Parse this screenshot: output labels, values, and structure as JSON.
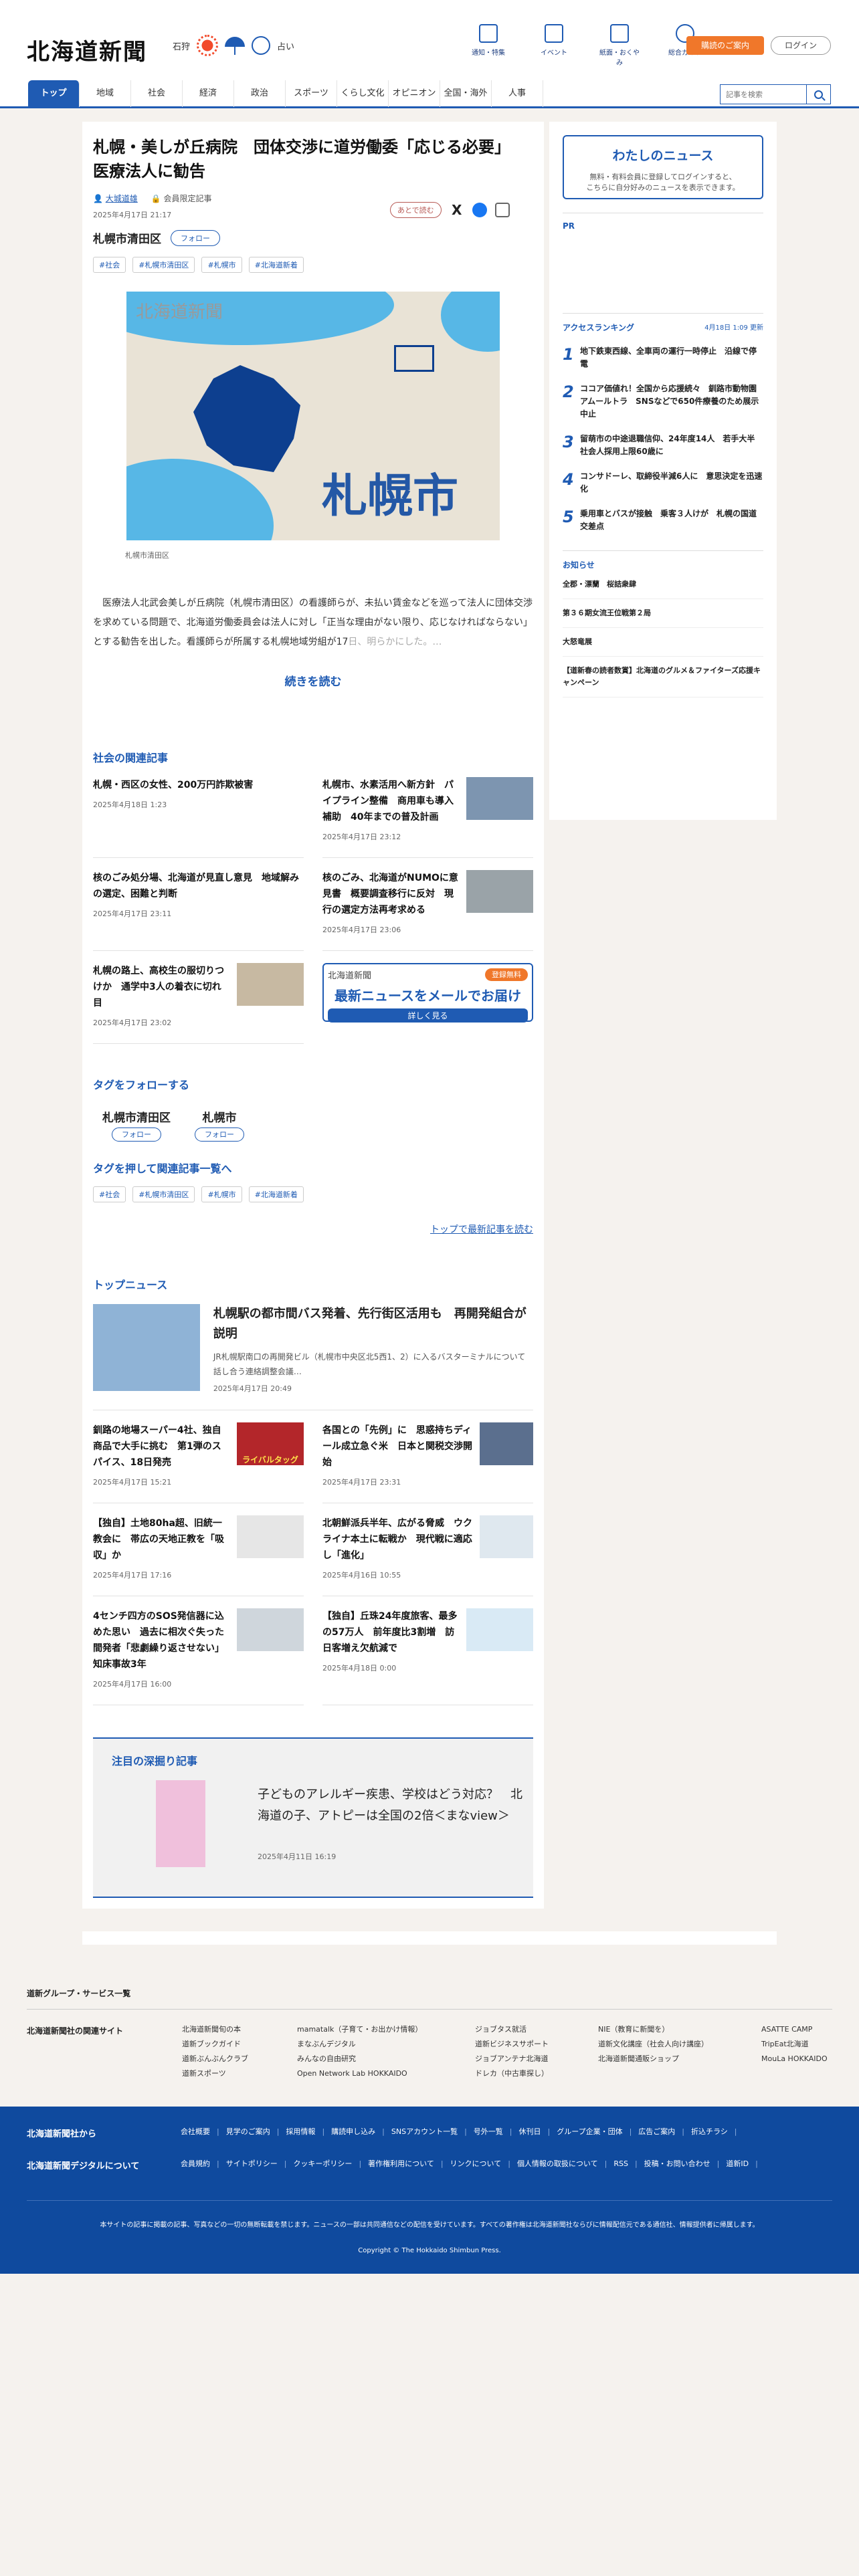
{
  "header": {
    "logo": "北海道新聞",
    "weather_area": "石狩",
    "fortune": "占い",
    "icons": [
      {
        "label": "通知・特集",
        "icon": "flag-icon"
      },
      {
        "label": "イベント",
        "icon": "calendar-icon"
      },
      {
        "label": "紙面・おくやみ",
        "icon": "newspaper-icon"
      },
      {
        "label": "総合ガイド",
        "icon": "question-icon"
      }
    ],
    "subscribe": "購読のご案内",
    "login": "ログイン"
  },
  "nav": {
    "items": [
      "トップ",
      "地域",
      "社会",
      "経済",
      "政治",
      "スポーツ",
      "くらし文化",
      "オピニオン",
      "全国・海外",
      "人事"
    ],
    "search_placeholder": "記事を検索"
  },
  "article": {
    "title": "札幌・美しが丘病院　団体交渉に道労働委「応じる必要」　医療法人に勧告",
    "author": "大城道雄",
    "paywall": "会員限定記事",
    "date": "2025年4月17日 21:17",
    "later": "あとで読む",
    "region": "札幌市清田区",
    "follow": "フォロー",
    "tags": [
      "#社会",
      "#札幌市清田区",
      "#札幌市",
      "#北海道新着"
    ],
    "map_logo": "北海道新聞",
    "map_label": "札幌市",
    "caption": "札幌市清田区",
    "body": "医療法人北武会美しが丘病院（札幌市清田区）の看護師らが、未払い賃金などを巡って法人に団体交渉を求めている問題で、北海道労働委員会は法人に対し「正当な理由がない限り、応じなければならない」とする勧告を出した。看護師らが所属する札幌地域労組が17",
    "body_fade": "日、明らかにした。…",
    "read_more": "続きを読む"
  },
  "related": {
    "heading": "社会の関連記事",
    "items": [
      {
        "title": "札幌・西区の女性、200万円詐欺被害",
        "date": "2025年4月18日 1:23"
      },
      {
        "title": "札幌市、水素活用へ新方針　パイプライン整備　商用車も導入補助　40年までの普及計画",
        "date": "2025年4月17日 23:12"
      },
      {
        "title": "核のごみ処分場、北海道が見直し意見　地域解みの選定、困難と判断",
        "date": "2025年4月17日 23:11"
      },
      {
        "title": "核のごみ、北海道がNUMOに意見書　概要調査移行に反対　現行の選定方法再考求める",
        "date": "2025年4月17日 23:06"
      },
      {
        "title": "札幌の路上、高校生の服切りつけか　通学中3人の着衣に切れ目",
        "date": "2025年4月17日 23:02"
      }
    ],
    "banner": {
      "logo": "北海道新聞",
      "badge": "登録無料",
      "title": "最新ニュースをメールでお届け",
      "button": "詳しく見る"
    }
  },
  "follow_tags": {
    "heading": "タグをフォローする",
    "items": [
      "札幌市清田区",
      "札幌市"
    ],
    "button": "フォロー"
  },
  "tag_search": {
    "heading": "タグを押して関連記事一覧へ",
    "tags": [
      "#社会",
      "#札幌市清田区",
      "#札幌市",
      "#北海道新着"
    ],
    "top_link": "トップで最新記事を読む"
  },
  "top_news": {
    "heading": "トップニュース",
    "lead": {
      "title": "札幌駅の都市間バス発着、先行街区活用も　再開発組合が説明",
      "summary": "JR札幌駅南口の再開発ビル（札幌市中央区北5西1、2）に入るバスターミナルについて話し合う連絡調整会議…",
      "date": "2025年4月17日 20:49"
    },
    "items": [
      {
        "title": "釧路の地場スーパー4社、独自商品で大手に挑む　第1弾のスパイス、18日発売",
        "date": "2025年4月17日 15:21"
      },
      {
        "title": "各国との「先例」に　思惑持ちディール成立急ぐ米　日本と関税交渉開始",
        "date": "2025年4月17日 23:31"
      },
      {
        "title": "【独自】土地80ha超、旧統一教会に　帯広の天地正教を「吸収」か",
        "date": "2025年4月17日 17:16"
      },
      {
        "title": "北朝鮮派兵半年、広がる脅威　ウクライナ本土に転戦か　現代戦に適応し「進化」",
        "date": "2025年4月16日 10:55"
      },
      {
        "title": "4センチ四方のSOS発信器に込めた思い　過去に相次ぐ失った間発者「悲劇繰り返させない」　知床事故3年",
        "date": "2025年4月17日 16:00"
      },
      {
        "title": "【独自】丘珠24年度旅客、最多の57万人　前年度比3割増　訪日客増え欠航減で",
        "date": "2025年4月18日 0:00"
      }
    ],
    "thumb_text": "ライバルタッグ"
  },
  "feature": {
    "heading": "注目の深掘り記事",
    "title": "子どものアレルギー疾患、学校はどう対応？　北海道の子、アトピーは全国の2倍＜まなview＞",
    "date": "2025年4月11日 16:19"
  },
  "sidebar": {
    "mynews_title": "わたしのニュース",
    "mynews_text1": "無料・有料会員に登録してログインすると、",
    "mynews_text2": "こちらに自分好みのニュースを表示できます。",
    "pr": "PR",
    "ranking_heading": "アクセスランキング",
    "ranking_updated": "4月18日 1:09 更新",
    "ranking": [
      {
        "n": "1",
        "title": "地下鉄東西線、全車両の運行一時停止　沿線で停電"
      },
      {
        "n": "2",
        "title": "ココア価値れ！全国から応援続々　釧路市動物園アムールトラ　SNSなどで650件療養のため展示中止"
      },
      {
        "n": "3",
        "title": "留萌市の中途退職信仰、24年度14人　若手大半　社会人採用上限60歳に"
      },
      {
        "n": "4",
        "title": "コンサドーレ、取締役半減6人に　意思決定を迅速化"
      },
      {
        "n": "5",
        "title": "乗用車とバスが接触　乗客３人けが　札幌の国道交差点"
      }
    ],
    "notice_heading": "お知らせ",
    "notices": [
      "全郡・漂蘭　桜詰衆肆",
      "第３６期女流王位戦第２局",
      "大怒竜展",
      "【道新春の読者数賞】北海道のグルメ＆ファイターズ応援キャンペーン"
    ]
  },
  "footer": {
    "group_heading": "道新グループ・サービス一覧",
    "related_label": "北海道新聞社の関連サイト",
    "cols": [
      [
        "北海道新聞旬の本",
        "道新ブックガイド",
        "道新ぶんぶんクラブ",
        "道新スポーツ"
      ],
      [
        "mamatalk（子育て・お出かけ情報）",
        "まなぶんデジタル",
        "みんなの自由研究",
        "Open Network Lab HOKKAIDO"
      ],
      [
        "ジョブタス就活",
        "道新ビジネスサポート",
        "ジョブアンテナ北海道",
        "ドレカ（中古車探し）"
      ],
      [
        "NIE（教育に新聞を）",
        "道新文化講座（社会人向け講座）",
        "北海道新聞通販ショップ"
      ],
      [
        "ASATTE CAMP",
        "TripEat北海道",
        "MouLa HOKKAIDO"
      ]
    ],
    "company_label": "北海道新聞社から",
    "company_links": [
      "会社概要",
      "見学のご案内",
      "採用情報",
      "購読申し込み",
      "SNSアカウント一覧",
      "号外一覧",
      "休刊日",
      "グループ企業・団体",
      "広告ご案内",
      "折込チラシ"
    ],
    "digital_label": "北海道新聞デジタルについて",
    "digital_links": [
      "会員規約",
      "サイトポリシー",
      "クッキーポリシー",
      "著作権利用について",
      "リンクについて",
      "個人情報の取扱について",
      "RSS",
      "投稿・お問い合わせ",
      "道新ID"
    ],
    "notice": "本サイトの記事に掲載の記事、写真などの一切の無断転載を禁じます。ニュースの一部は共同通信などの配信を受けています。すべての著作権は北海道新聞社ならびに情報配信元である通信社、情報提供者に帰属します。",
    "copyright": "Copyright © The Hokkaido Shimbun Press."
  },
  "colors": {
    "brand": "#1f5bb3",
    "accent": "#f0772a",
    "footer": "#0f4a9e"
  }
}
